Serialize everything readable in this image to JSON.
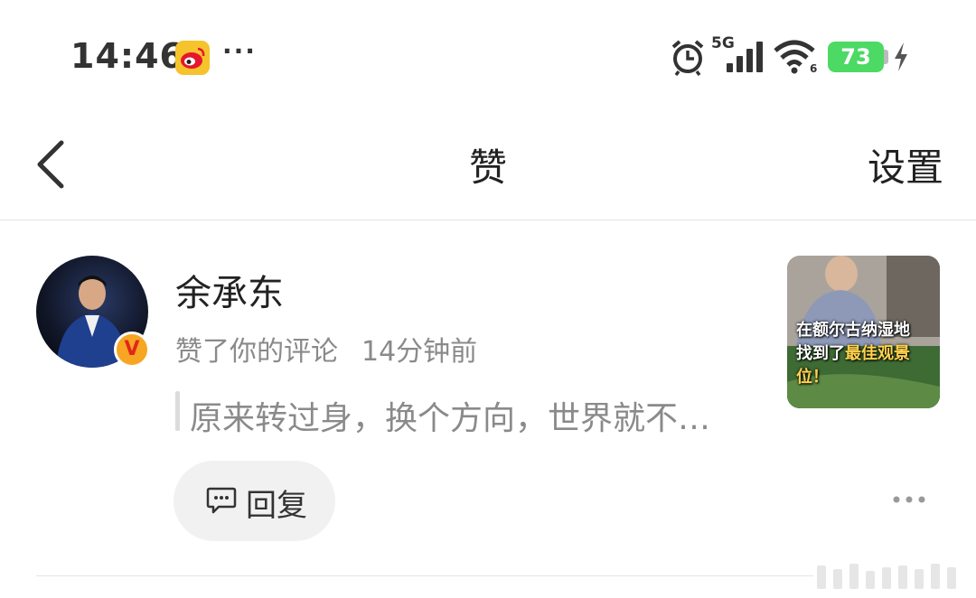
{
  "status_bar": {
    "time": "14:46",
    "menu_dots": "···",
    "network": "5G",
    "wifi_level": "6",
    "battery": "73",
    "battery_color": "#4cd964"
  },
  "nav": {
    "title": "赞",
    "settings_label": "设置"
  },
  "notification": {
    "username": "余承东",
    "action": "赞了你的评论",
    "time_ago": "14分钟前",
    "quoted_comment": "原来转过身，换个方向，世界就不…",
    "thumbnail_caption_line1": "在额尔古纳湿地",
    "thumbnail_caption_line2a": "找到了",
    "thumbnail_caption_line2b": "最佳观景位！",
    "reply_label": "回复",
    "verified_color": "#f6a623"
  }
}
